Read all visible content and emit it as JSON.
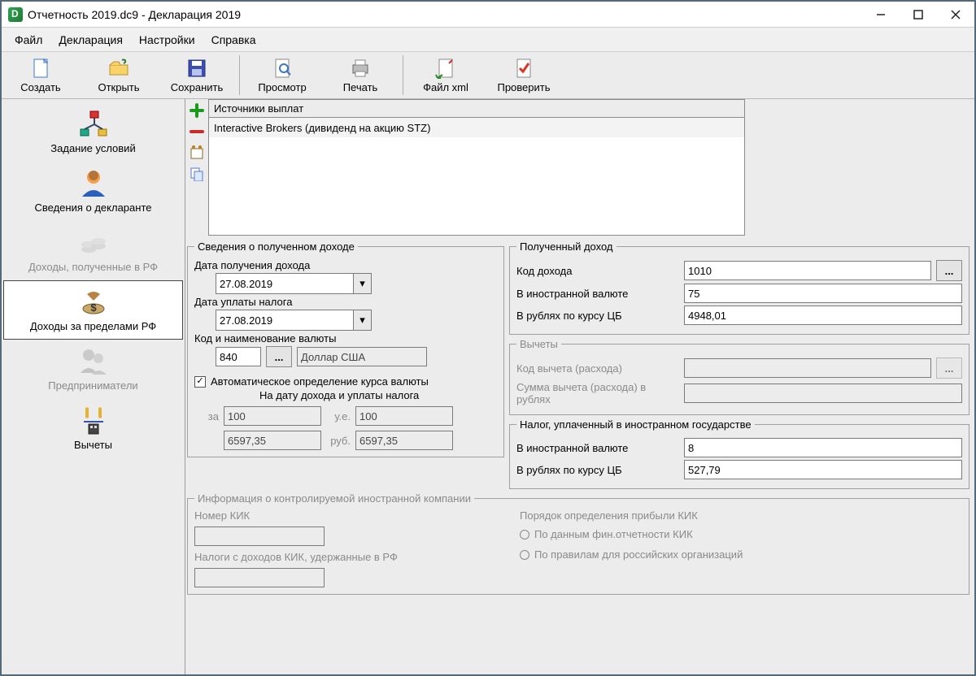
{
  "window": {
    "title": "Отчетность 2019.dc9 - Декларация 2019"
  },
  "menu": {
    "file": "Файл",
    "decl": "Декларация",
    "settings": "Настройки",
    "help": "Справка"
  },
  "toolbar": {
    "create": "Создать",
    "open": "Открыть",
    "save": "Сохранить",
    "preview": "Просмотр",
    "print": "Печать",
    "xml": "Файл xml",
    "check": "Проверить"
  },
  "sidebar": {
    "cond": "Задание условий",
    "decl": "Сведения о декларанте",
    "income_rf": "Доходы, полученные в РФ",
    "income_foreign": "Доходы за пределами РФ",
    "entrepreneurs": "Предприниматели",
    "deductions": "Вычеты"
  },
  "sources": {
    "header": "Источники выплат",
    "items": [
      "Interactive Brokers (дивиденд на акцию STZ)"
    ]
  },
  "income_info": {
    "legend": "Сведения о полученном доходе",
    "date_received_label": "Дата получения дохода",
    "date_received": "27.08.2019",
    "date_tax_label": "Дата уплаты налога",
    "date_tax": "27.08.2019",
    "currency_label": "Код и наименование валюты",
    "currency_code": "840",
    "currency_name": "Доллар США",
    "auto_rate_label": "Автоматическое определение курса валюты",
    "rate_mode_label": "На дату дохода и уплаты налога",
    "per_label": "за",
    "per_value": "100",
    "unit_label": "у.е.",
    "unit_value": "100",
    "rate1": "6597,35",
    "rub_label": "руб.",
    "rate2": "6597,35"
  },
  "received": {
    "legend": "Полученный доход",
    "code_label": "Код дохода",
    "code_value": "1010",
    "fx_label": "В иностранной валюте",
    "fx_value": "75",
    "rub_label": "В рублях по курсу ЦБ",
    "rub_value": "4948,01"
  },
  "deduct": {
    "legend": "Вычеты",
    "code_label": "Код вычета (расхода)",
    "sum_label": "Сумма вычета (расхода) в рублях"
  },
  "foreign_tax": {
    "legend": "Налог, уплаченный в иностранном государстве",
    "fx_label": "В иностранной валюте",
    "fx_value": "8",
    "rub_label": "В рублях по курсу ЦБ",
    "rub_value": "527,79"
  },
  "kik": {
    "legend": "Информация о контролируемой иностранной компании",
    "num_label": "Номер КИК",
    "tax_label": "Налоги с доходов КИК, удержанные в РФ",
    "order_label": "Порядок определения прибыли КИК",
    "opt1": "По данным фин.отчетности КИК",
    "opt2": "По правилам для российских организаций"
  }
}
